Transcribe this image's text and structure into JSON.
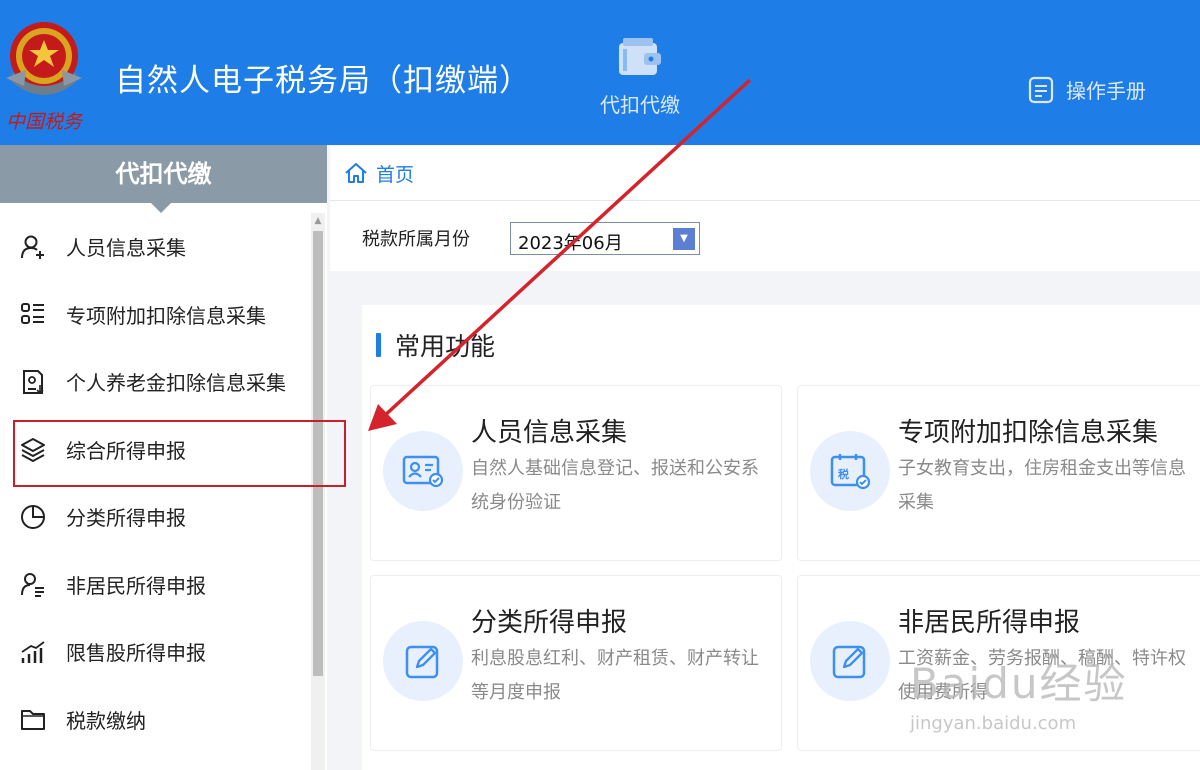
{
  "header": {
    "emblem_text": "中国税务",
    "app_title": "自然人电子税务局（扣缴端）",
    "nav_item": "代扣代缴",
    "manual_label": "操作手册"
  },
  "sidebar": {
    "title": "代扣代缴",
    "items": [
      {
        "label": "人员信息采集",
        "icon": "person-add-icon"
      },
      {
        "label": "专项附加扣除信息采集",
        "icon": "list-grid-icon"
      },
      {
        "label": "个人养老金扣除信息采集",
        "icon": "pension-doc-icon"
      },
      {
        "label": "综合所得申报",
        "icon": "layers-icon"
      },
      {
        "label": "分类所得申报",
        "icon": "pie-chart-icon"
      },
      {
        "label": "非居民所得申报",
        "icon": "person-list-icon"
      },
      {
        "label": "限售股所得申报",
        "icon": "bar-trend-icon"
      },
      {
        "label": "税款缴纳",
        "icon": "folder-icon"
      }
    ],
    "highlighted_item": "综合所得申报"
  },
  "breadcrumb": {
    "home": "首页"
  },
  "filter": {
    "month_label": "税款所属月份",
    "month_value": "2023年06月"
  },
  "main": {
    "section_title": "常用功能",
    "cards": [
      {
        "title": "人员信息采集",
        "desc": "自然人基础信息登记、报送和公安系统身份验证",
        "icon": "id-card-icon"
      },
      {
        "title": "专项附加扣除信息采集",
        "desc": "子女教育支出，住房租金支出等信息采集",
        "icon": "tax-calendar-icon"
      },
      {
        "title": "分类所得申报",
        "desc": "利息股息红利、财产租赁、财产转让等月度申报",
        "icon": "edit-icon"
      },
      {
        "title": "非居民所得申报",
        "desc": "工资薪金、劳务报酬、稿酬、特许权使用费所得",
        "icon": "edit-icon"
      }
    ]
  },
  "watermark": {
    "line1": "Baidu经验",
    "line2": "jingyan.baidu.com"
  },
  "colors": {
    "header_blue": "#1e7de6",
    "sidebar_header": "#8a9aa6",
    "highlight_red": "#c8202a"
  }
}
